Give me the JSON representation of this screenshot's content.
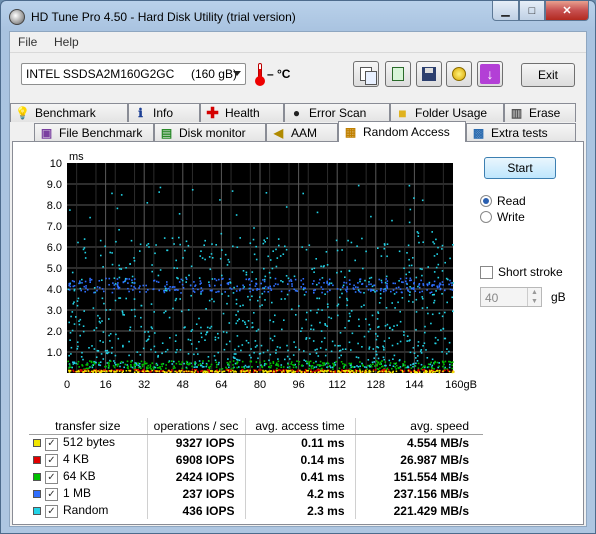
{
  "window": {
    "title": "HD Tune Pro 4.50 - Hard Disk Utility (trial version)",
    "min_glyph": "▁",
    "max_glyph": "□",
    "close_glyph": "✕"
  },
  "menu": {
    "file": "File",
    "help": "Help"
  },
  "toolbar": {
    "drive": "INTEL SSDSA2M160G2GC     (160 gB)",
    "temperature": "– °C",
    "buttons": [
      "copy-info-icon",
      "copy-screenshot-icon",
      "save-icon",
      "options-icon",
      "download-icon"
    ],
    "exit_label": "Exit"
  },
  "tabs_row1": [
    {
      "label": "Benchmark",
      "icon": "lightbulb-icon"
    },
    {
      "label": "Info",
      "icon": "info-icon"
    },
    {
      "label": "Health",
      "icon": "health-cross-icon"
    },
    {
      "label": "Error Scan",
      "icon": "error-scan-icon"
    },
    {
      "label": "Folder Usage",
      "icon": "folder-icon"
    },
    {
      "label": "Erase",
      "icon": "trash-icon"
    }
  ],
  "tabs_row2": [
    {
      "label": "File Benchmark",
      "icon": "file-benchmark-icon"
    },
    {
      "label": "Disk monitor",
      "icon": "disk-monitor-icon"
    },
    {
      "label": "AAM",
      "icon": "speaker-icon"
    },
    {
      "label": "Random Access",
      "icon": "random-access-icon",
      "active": true
    },
    {
      "label": "Extra tests",
      "icon": "extra-tests-icon"
    }
  ],
  "controls": {
    "start_label": "Start",
    "read_label": "Read",
    "write_label": "Write",
    "mode_selected": "Read",
    "short_stroke_label": "Short stroke",
    "short_stroke_checked": false,
    "short_stroke_value": "40",
    "short_stroke_unit": "gB",
    "check_mark": "✓",
    "spin_up": "▲",
    "spin_down": "▼"
  },
  "table": {
    "headers": [
      "transfer size",
      "operations / sec",
      "avg. access time",
      "avg. speed"
    ],
    "rows": [
      {
        "name": "512 bytes",
        "color": "#f2e600",
        "ops": "9327 IOPS",
        "access": "0.11 ms",
        "speed": "4.554 MB/s",
        "checked": true
      },
      {
        "name": "4 KB",
        "color": "#e00000",
        "ops": "6908 IOPS",
        "access": "0.14 ms",
        "speed": "26.987 MB/s",
        "checked": true
      },
      {
        "name": "64 KB",
        "color": "#00c000",
        "ops": "2424 IOPS",
        "access": "0.41 ms",
        "speed": "151.554 MB/s",
        "checked": true
      },
      {
        "name": "1 MB",
        "color": "#2f6fff",
        "ops": "237 IOPS",
        "access": "4.2 ms",
        "speed": "237.156 MB/s",
        "checked": true
      },
      {
        "name": "Random",
        "color": "#22d3e6",
        "ops": "436 IOPS",
        "access": "2.3 ms",
        "speed": "221.429 MB/s",
        "checked": true
      }
    ]
  },
  "chart_data": {
    "type": "scatter",
    "ylabel": "ms",
    "xlabel": "gB",
    "xlim": [
      0,
      160
    ],
    "ylim": [
      0,
      10
    ],
    "x_ticks": [
      "0",
      "16",
      "32",
      "48",
      "64",
      "80",
      "96",
      "112",
      "128",
      "144",
      "160gB"
    ],
    "y_ticks": [
      "10",
      "9.0",
      "8.0",
      "7.0",
      "6.0",
      "5.0",
      "4.0",
      "3.0",
      "2.0",
      "1.0"
    ],
    "grid": true,
    "background": "#000000",
    "series": [
      {
        "name": "512 bytes",
        "color": "#f2e600",
        "mean_ms": 0.11,
        "spread_ms": 0.05
      },
      {
        "name": "4 KB",
        "color": "#e00000",
        "mean_ms": 0.14,
        "spread_ms": 0.06
      },
      {
        "name": "64 KB",
        "color": "#00c000",
        "mean_ms": 0.41,
        "spread_ms": 0.2
      },
      {
        "name": "1 MB",
        "color": "#2f6fff",
        "mean_ms": 4.2,
        "spread_ms": 0.35
      },
      {
        "name": "Random",
        "color": "#22d3e6",
        "mean_ms": 2.3,
        "spread_ms": 1.8
      }
    ]
  }
}
